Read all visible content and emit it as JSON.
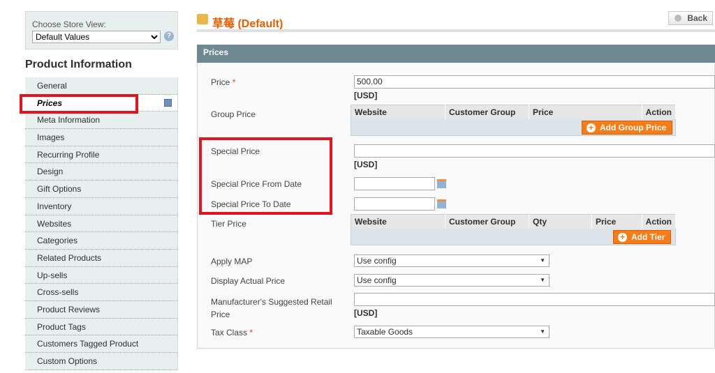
{
  "store_view": {
    "label": "Choose Store View:",
    "selected": "Default Values"
  },
  "sidebar": {
    "heading": "Product Information",
    "items": [
      {
        "label": "General"
      },
      {
        "label": "Prices",
        "active": true
      },
      {
        "label": "Meta Information"
      },
      {
        "label": "Images"
      },
      {
        "label": "Recurring Profile"
      },
      {
        "label": "Design"
      },
      {
        "label": "Gift Options"
      },
      {
        "label": "Inventory"
      },
      {
        "label": "Websites"
      },
      {
        "label": "Categories"
      },
      {
        "label": "Related Products"
      },
      {
        "label": "Up-sells"
      },
      {
        "label": "Cross-sells"
      },
      {
        "label": "Product Reviews"
      },
      {
        "label": "Product Tags"
      },
      {
        "label": "Customers Tagged Product"
      },
      {
        "label": "Custom Options"
      }
    ]
  },
  "header": {
    "title": "草莓 (Default)",
    "back_label": "Back"
  },
  "section": {
    "title": "Prices"
  },
  "form": {
    "price": {
      "label": "Price",
      "required": "*",
      "value": "500.00",
      "currency": "[USD]"
    },
    "group_price": {
      "label": "Group Price",
      "columns": [
        "Website",
        "Customer Group",
        "Price",
        "Action"
      ],
      "button": "Add Group Price"
    },
    "special_price": {
      "label": "Special Price",
      "value": "",
      "currency": "[USD]"
    },
    "special_from": {
      "label": "Special Price From Date",
      "value": ""
    },
    "special_to": {
      "label": "Special Price To Date",
      "value": ""
    },
    "tier_price": {
      "label": "Tier Price",
      "columns": [
        "Website",
        "Customer Group",
        "Qty",
        "Price",
        "Action"
      ],
      "button": "Add Tier"
    },
    "apply_map": {
      "label": "Apply MAP",
      "value": "Use config"
    },
    "display_actual": {
      "label": "Display Actual Price",
      "value": "Use config"
    },
    "msrp": {
      "label": "Manufacturer's Suggested Retail Price",
      "value": "",
      "currency": "[USD]"
    },
    "tax_class": {
      "label": "Tax Class",
      "required": "*",
      "value": "Taxable Goods"
    }
  },
  "colors": {
    "accent": "#eb5e00",
    "highlight": "#e3141b",
    "button": "#f77c16",
    "section_header": "#6f8992"
  }
}
